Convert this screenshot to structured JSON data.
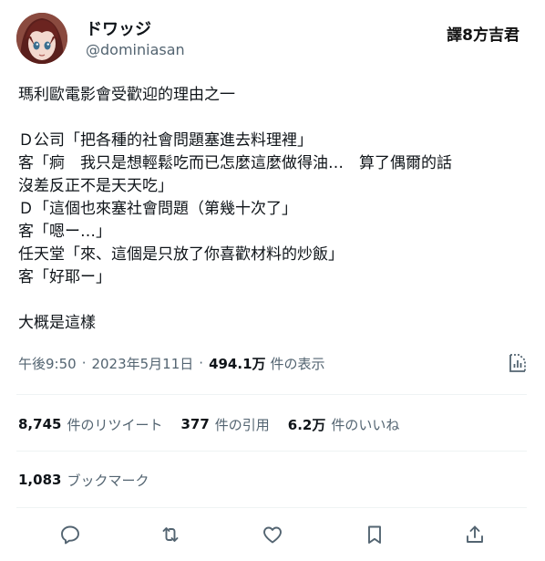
{
  "user": {
    "display_name": "ドワッジ",
    "handle": "@dominiasan"
  },
  "watermark": "譯8方吉君",
  "tweet": {
    "lines": [
      "瑪利歐電影會受歡迎的理由之一",
      "",
      "Ｄ公司「把各種的社會問題塞進去料理裡」",
      "客「痾　我只是想輕鬆吃而已怎麼這麼做得油…　算了偶爾的話",
      "沒差反正不是天天吃」",
      "Ｄ「這個也來塞社會問題（第幾十次了」",
      "客「嗯ー…」",
      "任天堂「來、這個是只放了你喜歡材料的炒飯」",
      "客「好耶ー」",
      "",
      "大概是這樣"
    ]
  },
  "meta": {
    "time": "午後9:50",
    "date": "2023年5月11日",
    "separator": "·",
    "views_count": "494.1万",
    "views_label": "件の表示"
  },
  "stats": {
    "retweets_count": "8,745",
    "retweets_label": "件のリツイート",
    "quotes_count": "377",
    "quotes_label": "件の引用",
    "likes_count": "6.2万",
    "likes_label": "件のいいね",
    "bookmarks_count": "1,083",
    "bookmarks_label": "ブックマーク"
  },
  "icons": {
    "analytics": "analytics-icon",
    "reply": "reply-icon",
    "retweet": "retweet-icon",
    "like": "heart-icon",
    "bookmark": "bookmark-icon",
    "share": "share-icon"
  },
  "colors": {
    "text_primary": "#0f1419",
    "text_secondary": "#536471",
    "divider": "#eff3f4",
    "icon": "#536471"
  }
}
